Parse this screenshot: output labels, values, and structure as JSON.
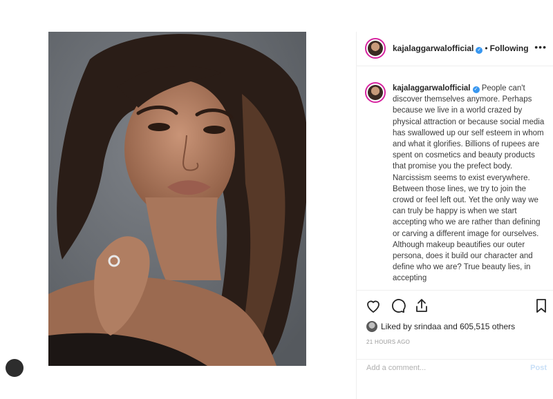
{
  "post": {
    "username": "kajalaggarwalofficial",
    "verified_mark": "✓",
    "separator": "•",
    "follow_status": "Following",
    "more_icon": "•••",
    "caption": "People can't discover themselves anymore. Perhaps because we live in a world crazed by physical attraction or because social media has swallowed up our self esteem in whom and what it glorifies. Billions of rupees are spent on cosmetics and beauty products that promise you the prefect body. Narcissism seems to exist everywhere. Between those lines, we try to join the crowd or feel left out. Yet the only way we can truly be happy is when we start accepting who we are rather than defining or carving a different image for ourselves. Although makeup beautifies our outer persona, does it build our character and define who we are? True beauty lies, in accepting",
    "likes_text": "Liked by srindaa and 605,515 others",
    "timestamp": "21 HOURS AGO",
    "comment_placeholder": "Add a comment...",
    "post_label": "Post"
  },
  "icons": {
    "like": "heart-icon",
    "comment": "comment-icon",
    "share": "share-icon",
    "save": "bookmark-icon"
  },
  "colors": {
    "verified": "#3897f0",
    "border": "#efefef",
    "muted": "#999999",
    "avatar_ring": "#d6249f"
  }
}
